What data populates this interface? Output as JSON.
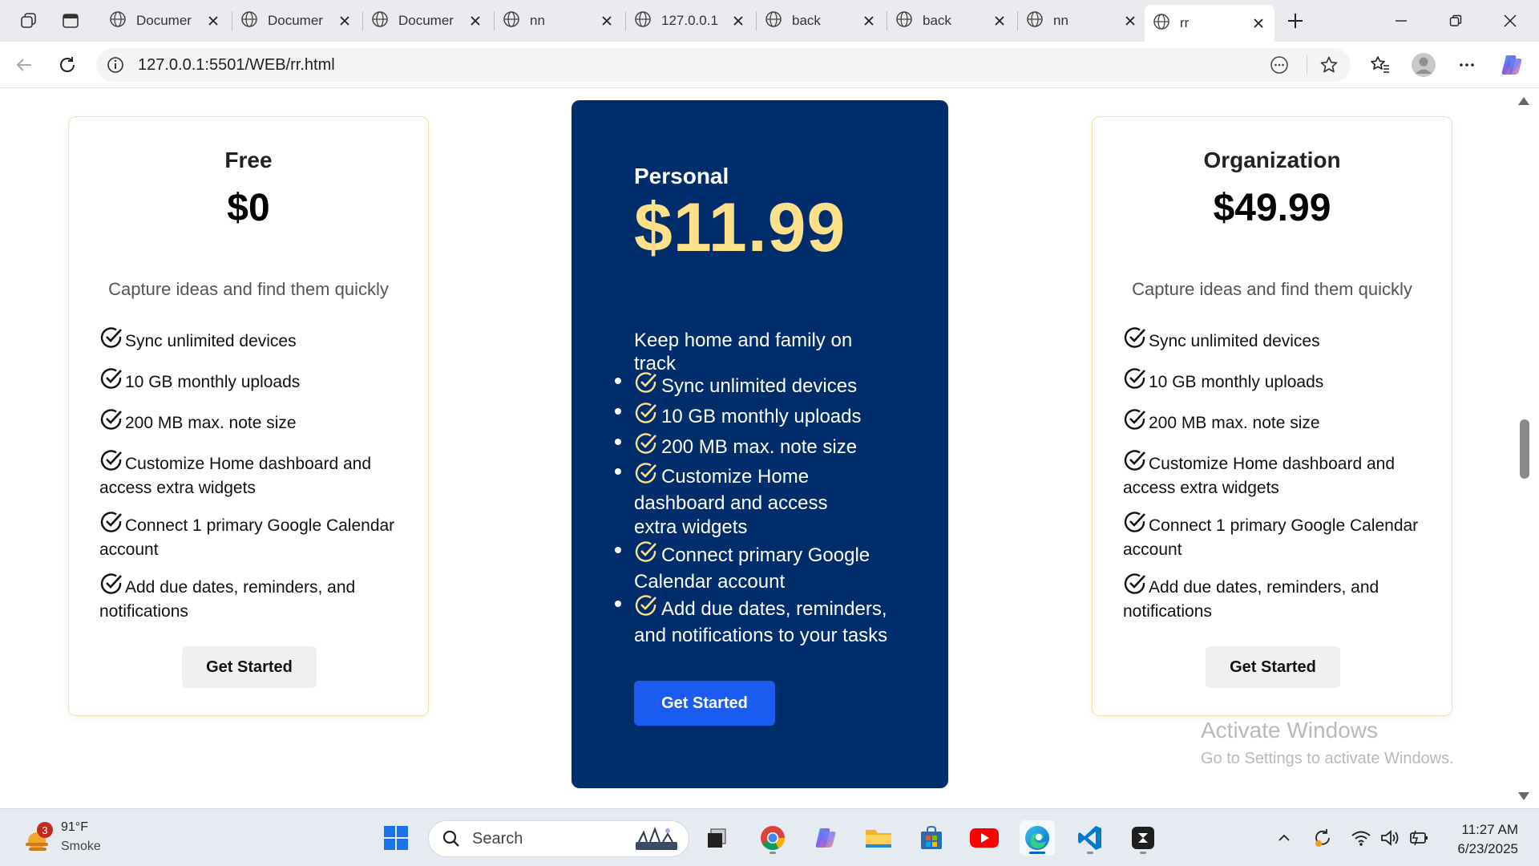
{
  "browser": {
    "tabs": [
      {
        "title": "Documer",
        "active": false
      },
      {
        "title": "Documer",
        "active": false
      },
      {
        "title": "Documer",
        "active": false
      },
      {
        "title": "nn",
        "active": false
      },
      {
        "title": "127.0.0.1",
        "active": false
      },
      {
        "title": "back",
        "active": false
      },
      {
        "title": "back",
        "active": false
      },
      {
        "title": "nn",
        "active": false
      },
      {
        "title": "rr",
        "active": true
      }
    ],
    "url": "127.0.0.1:5501/WEB/rr.html"
  },
  "plans": {
    "free": {
      "name": "Free",
      "price": "$0",
      "description": "Capture ideas and find them quickly",
      "features": [
        "Sync unlimited devices",
        "10 GB monthly uploads",
        "200 MB max. note size",
        "Customize Home dashboard and access extra widgets",
        "Connect 1 primary Google Calendar account",
        "Add due dates, reminders, and notifications"
      ],
      "button": "Get Started"
    },
    "personal": {
      "name": "Personal",
      "price": "$11.99",
      "description": "Keep home and family on track",
      "features": [
        "Sync unlimited devices",
        "10 GB monthly uploads",
        "200 MB max. note size",
        "Customize Home dashboard and access extra widgets",
        "Connect primary Google Calendar account",
        "Add due dates, reminders, and notifications to your tasks"
      ],
      "button": "Get Started"
    },
    "organization": {
      "name": "Organization",
      "price": "$49.99",
      "description": "Capture ideas and find them quickly",
      "features": [
        "Sync unlimited devices",
        "10 GB monthly uploads",
        "200 MB max. note size",
        "Customize Home dashboard and access extra widgets",
        "Connect 1 primary Google Calendar account",
        "Add due dates, reminders, and notifications"
      ],
      "button": "Get Started"
    }
  },
  "watermark": {
    "title": "Activate Windows",
    "subtitle": "Go to Settings to activate Windows."
  },
  "taskbar": {
    "weather_badge": "3",
    "weather_temp": "91°F",
    "weather_desc": "Smoke",
    "search_placeholder": "Search",
    "time": "11:27 AM",
    "date": "6/23/2025"
  },
  "colors": {
    "dark_card": "#002d6b",
    "price_highlight": "#ffe08a",
    "primary_button": "#1a5cf0",
    "light_card_border": "#f3e3a8"
  }
}
